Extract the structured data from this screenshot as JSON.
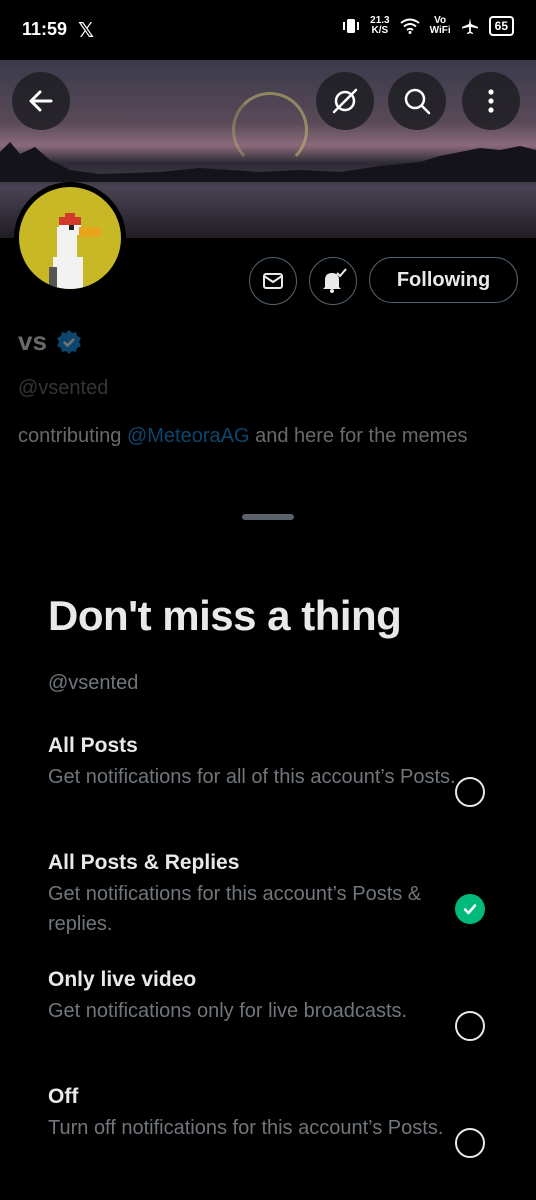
{
  "status_bar": {
    "time": "11:59",
    "x_logo": "𝕏",
    "speed_value": "21.3",
    "speed_unit": "K/S",
    "vo_label": "Vo",
    "wifi_label": "WiFi",
    "battery": "65"
  },
  "banner": {
    "icons": [
      "back-arrow-icon",
      "translate-off-icon",
      "search-icon",
      "more-vertical-icon"
    ]
  },
  "profile": {
    "display_name": "vs",
    "handle": "@vsented",
    "bio_prefix": "contributing ",
    "bio_mention": "@MeteoraAG",
    "bio_suffix": " and here for the memes",
    "following_label": "Following",
    "verified_color": "#1d9bf0"
  },
  "sheet": {
    "title": "Don't miss a thing",
    "handle": "@vsented",
    "options": [
      {
        "label": "All Posts",
        "description": "Get notifications for all of this account’s Posts.",
        "selected": false
      },
      {
        "label": "All Posts & Replies",
        "description": "Get notifications for this account’s Posts & replies.",
        "selected": true
      },
      {
        "label": "Only live video",
        "description": "Get notifications only for live broadcasts.",
        "selected": false
      },
      {
        "label": "Off",
        "description": "Turn off notifications for this account’s Posts.",
        "selected": false
      }
    ],
    "selected_color": "#00ba7c"
  }
}
